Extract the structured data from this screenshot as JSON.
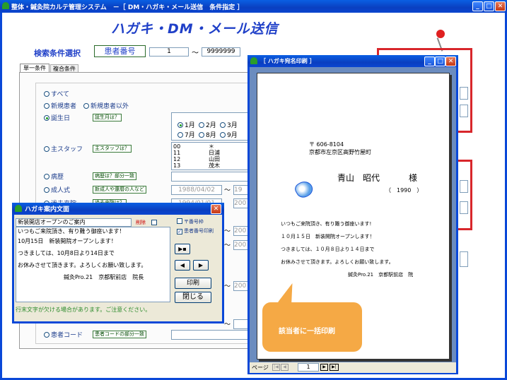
{
  "app": {
    "title": "整体・鍼灸院カルテ管理システム　－［ DM・ハガキ・メール送信　条件指定 ］",
    "heading": "ハガキ・DM・メール送信"
  },
  "search": {
    "label": "検索条件選択",
    "field": "患者番号",
    "from": "1",
    "tilde": "～",
    "to": "9999999"
  },
  "tabs": [
    "単一条件",
    "複合条件"
  ],
  "conditions": {
    "all": "すべて",
    "new": "新規患者",
    "not_new": "新規患者以外",
    "birthday": "誕生日",
    "birthday_btn": "誕生月は？",
    "months": [
      "1月",
      "2月",
      "3月",
      "7月",
      "8月",
      "9月"
    ],
    "staff": "主スタッフ",
    "staff_btn": "主スタッフは？",
    "staff_list": [
      [
        "00",
        "＊"
      ],
      [
        "11",
        "日浦"
      ],
      [
        "12",
        "山田"
      ],
      [
        "13",
        "茂木"
      ]
    ],
    "history": "病歴",
    "history_btn": "病歴は？部分一致",
    "adult": "成人式",
    "adult_btn": "新成人や還暦の人など",
    "adult_from": "1988/04/02",
    "adult_to": "19",
    "past": "過去来院",
    "past_btn": "過去来院は？",
    "past_from": "1994/01/01",
    "past_to": "200",
    "range_tail": [
      "200",
      "200",
      "200"
    ],
    "patient_code": "患者コード",
    "patient_code_btn": "患者コードの部分一致"
  },
  "dialog": {
    "title": "ハガキ案内文面",
    "subject": "新装開店オープンのご案内",
    "delete": "削除",
    "cb_yubin": "〒番号枠",
    "cb_kanja": "患者番号印刷",
    "body_lines": [
      "いつもご来院頂き、有り難う御座います！",
      "10月15日　新装開院オープンします！",
      "つきましては、10月8日より14日まで",
      "お休みさせて頂きます。よろしくお願い致します。",
      "鍼灸Pro.21　京都駅前店　院長"
    ],
    "nav_first": "▶▪",
    "nav_prev": "◀",
    "nav_next": "▶",
    "print": "印刷",
    "close": "閉じる",
    "note": "行末文字が欠ける場合があります。ご注意ください。"
  },
  "preview": {
    "title": "［ ハガキ宛名印刷 ］",
    "postal": "〒 606-8104",
    "address": "京都市左京区高野竹屋町",
    "name": "青山　昭代",
    "honorific": "様",
    "year": "（　1990　）",
    "lines": [
      "いつもご来院頂き、有り難う御座います!",
      "１０月１５日　新装開院オープンします！",
      "つきましては、１０月８日より１４日まで",
      "お休みさせて頂きます。よろしくお願い致します。",
      "鍼灸Pro.21　京都駅前店　院"
    ],
    "page_label": "ページ",
    "page": "1"
  },
  "callout": "該当者に一括印刷",
  "colors": {
    "xp_blue": "#0a48d8",
    "heading": "#2040c8",
    "callout": "#f5a945",
    "pin": "#e02020"
  }
}
